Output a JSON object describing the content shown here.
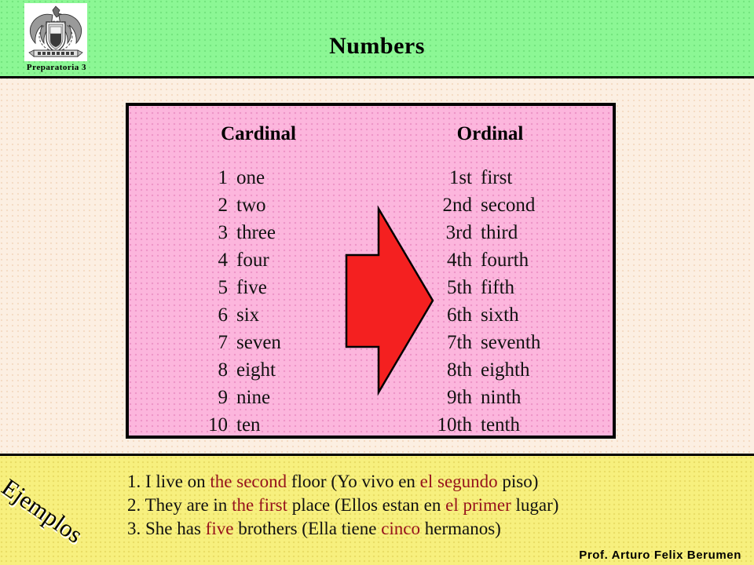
{
  "header": {
    "title": "Numbers",
    "logo_caption": "Preparatoria 3",
    "logo_icon": "university-shield-eagle-icon",
    "bg_color": "#8cf795"
  },
  "table": {
    "columns": [
      {
        "heading": "Cardinal"
      },
      {
        "heading": "Ordinal"
      }
    ],
    "cardinal": [
      {
        "num": "1",
        "word": "one"
      },
      {
        "num": "2",
        "word": "two"
      },
      {
        "num": "3",
        "word": "three"
      },
      {
        "num": "4",
        "word": "four"
      },
      {
        "num": "5",
        "word": "five"
      },
      {
        "num": "6",
        "word": "six"
      },
      {
        "num": "7",
        "word": "seven"
      },
      {
        "num": "8",
        "word": "eight"
      },
      {
        "num": "9",
        "word": "nine"
      },
      {
        "num": "10",
        "word": "ten"
      }
    ],
    "ordinal": [
      {
        "num": "1st",
        "word": "first"
      },
      {
        "num": "2nd",
        "word": "second"
      },
      {
        "num": "3rd",
        "word": "third"
      },
      {
        "num": "4th",
        "word": "fourth"
      },
      {
        "num": "5th",
        "word": "fifth"
      },
      {
        "num": "6th",
        "word": "sixth"
      },
      {
        "num": "7th",
        "word": "seventh"
      },
      {
        "num": "8th",
        "word": "eighth"
      },
      {
        "num": "9th",
        "word": "ninth"
      },
      {
        "num": "10th",
        "word": "tenth"
      }
    ],
    "arrow_icon": "right-arrow-icon",
    "arrow_color": "#f42020",
    "panel_color": "#fcb6dd"
  },
  "examples": {
    "label": "Ejemplos",
    "bg_color": "#f7f07e",
    "highlight_color": "#96121c",
    "lines": [
      {
        "number": "1.",
        "en_before": " I live on ",
        "en_highlight": "the second",
        "en_after": " floor  (Yo vivo en ",
        "es_highlight": "el segundo",
        "es_after": " piso)"
      },
      {
        "number": "2.",
        "en_before": " They are in ",
        "en_highlight": "the first",
        "en_after": " place  (Ellos estan en ",
        "es_highlight": "el primer",
        "es_after": " lugar)"
      },
      {
        "number": "3.",
        "en_before": " She has ",
        "en_highlight": "five",
        "en_after": " brothers  (Ella tiene ",
        "es_highlight": "cinco",
        "es_after": " hermanos)"
      }
    ],
    "credit": "Prof. Arturo Felix Berumen"
  }
}
